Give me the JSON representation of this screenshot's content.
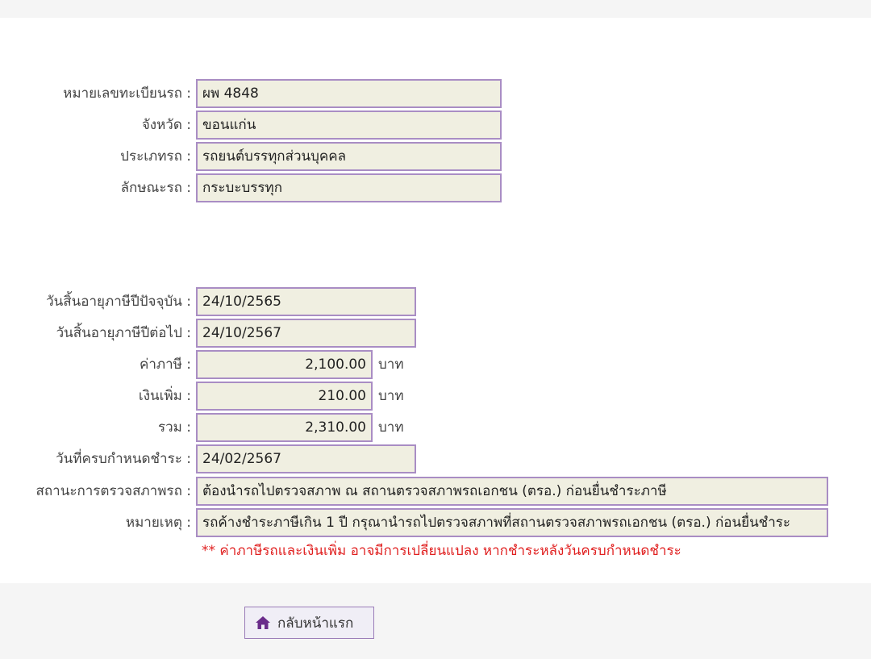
{
  "vehicle": {
    "plate_label": "หมายเลขทะเบียนรถ :",
    "plate_value": "ผพ 4848",
    "province_label": "จังหวัด :",
    "province_value": "ขอนแก่น",
    "type_label": "ประเภทรถ :",
    "type_value": "รถยนต์บรรทุกส่วนบุคคล",
    "style_label": "ลักษณะรถ :",
    "style_value": "กระบะบรรทุก"
  },
  "tax": {
    "current_expiry_label": "วันสิ้นอายุภาษีปีปัจจุบัน :",
    "current_expiry_value": "24/10/2565",
    "next_expiry_label": "วันสิ้นอายุภาษีปีต่อไป :",
    "next_expiry_value": "24/10/2567",
    "tax_amount_label": "ค่าภาษี :",
    "tax_amount_value": "2,100.00",
    "surcharge_label": "เงินเพิ่ม :",
    "surcharge_value": "210.00",
    "total_label": "รวม :",
    "total_value": "2,310.00",
    "currency_unit": "บาท",
    "due_date_label": "วันที่ครบกำหนดชำระ :",
    "due_date_value": "24/02/2567",
    "inspection_status_label": "สถานะการตรวจสภาพรถ :",
    "inspection_status_value": "ต้องนำรถไปตรวจสภาพ ณ สถานตรวจสภาพรถเอกชน (ตรอ.) ก่อนยื่นชำระภาษี",
    "remark_label": "หมายเหตุ :",
    "remark_value": "รถค้างชำระภาษีเกิน 1 ปี กรุณานำรถไปตรวจสภาพที่สถานตรวจสภาพรถเอกชน (ตรอ.) ก่อนยื่นชำระ",
    "warning_note": "** ค่าภาษีรถและเงินเพิ่ม อาจมีการเปลี่ยนแปลง หากชำระหลังวันครบกำหนดชำระ"
  },
  "footer": {
    "back_button_label": "กลับหน้าแรก",
    "back_button_icon": "home-icon"
  },
  "colors": {
    "field_background": "#f0efe1",
    "field_border": "#a98dc4",
    "warning_text": "#e02020",
    "icon_color": "#6a2c8a"
  }
}
